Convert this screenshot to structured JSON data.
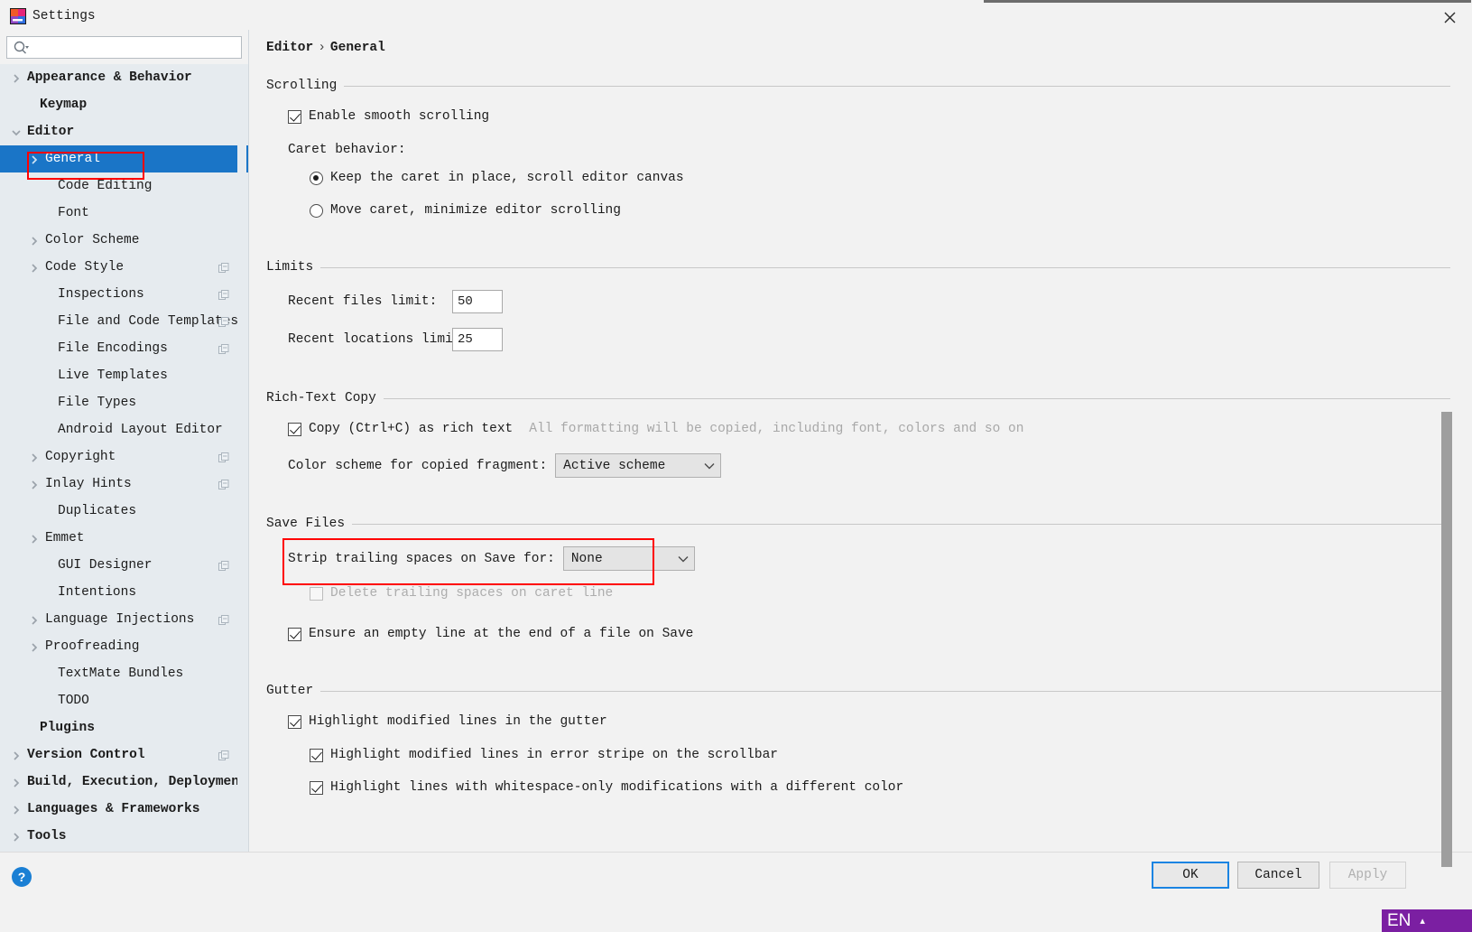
{
  "window": {
    "title": "Settings",
    "app_icon": "jetbrains-icon",
    "close_icon": "close-icon"
  },
  "search": {
    "value": "",
    "placeholder": "",
    "icon": "search-icon"
  },
  "sidebar": {
    "items": [
      {
        "label": "Appearance & Behavior",
        "indent": 16,
        "arrow": "chevron-right",
        "bold": true,
        "badge": false,
        "selected": false
      },
      {
        "label": "Keymap",
        "indent": 30,
        "arrow": "none",
        "bold": true,
        "badge": false,
        "selected": false
      },
      {
        "label": "Editor",
        "indent": 16,
        "arrow": "chevron-down",
        "bold": true,
        "badge": false,
        "selected": false
      },
      {
        "label": "General",
        "indent": 36,
        "arrow": "chevron-right",
        "bold": false,
        "badge": false,
        "selected": true
      },
      {
        "label": "Code Editing",
        "indent": 50,
        "arrow": "none",
        "bold": false,
        "badge": false,
        "selected": false
      },
      {
        "label": "Font",
        "indent": 50,
        "arrow": "none",
        "bold": false,
        "badge": false,
        "selected": false
      },
      {
        "label": "Color Scheme",
        "indent": 36,
        "arrow": "chevron-right",
        "bold": false,
        "badge": false,
        "selected": false
      },
      {
        "label": "Code Style",
        "indent": 36,
        "arrow": "chevron-right",
        "bold": false,
        "badge": true,
        "selected": false
      },
      {
        "label": "Inspections",
        "indent": 50,
        "arrow": "none",
        "bold": false,
        "badge": true,
        "selected": false
      },
      {
        "label": "File and Code Templates",
        "indent": 50,
        "arrow": "none",
        "bold": false,
        "badge": true,
        "selected": false
      },
      {
        "label": "File Encodings",
        "indent": 50,
        "arrow": "none",
        "bold": false,
        "badge": true,
        "selected": false
      },
      {
        "label": "Live Templates",
        "indent": 50,
        "arrow": "none",
        "bold": false,
        "badge": false,
        "selected": false
      },
      {
        "label": "File Types",
        "indent": 50,
        "arrow": "none",
        "bold": false,
        "badge": false,
        "selected": false
      },
      {
        "label": "Android Layout Editor",
        "indent": 50,
        "arrow": "none",
        "bold": false,
        "badge": false,
        "selected": false
      },
      {
        "label": "Copyright",
        "indent": 36,
        "arrow": "chevron-right",
        "bold": false,
        "badge": true,
        "selected": false
      },
      {
        "label": "Inlay Hints",
        "indent": 36,
        "arrow": "chevron-right",
        "bold": false,
        "badge": true,
        "selected": false
      },
      {
        "label": "Duplicates",
        "indent": 50,
        "arrow": "none",
        "bold": false,
        "badge": false,
        "selected": false
      },
      {
        "label": "Emmet",
        "indent": 36,
        "arrow": "chevron-right",
        "bold": false,
        "badge": false,
        "selected": false
      },
      {
        "label": "GUI Designer",
        "indent": 50,
        "arrow": "none",
        "bold": false,
        "badge": true,
        "selected": false
      },
      {
        "label": "Intentions",
        "indent": 50,
        "arrow": "none",
        "bold": false,
        "badge": false,
        "selected": false
      },
      {
        "label": "Language Injections",
        "indent": 36,
        "arrow": "chevron-right",
        "bold": false,
        "badge": true,
        "selected": false
      },
      {
        "label": "Proofreading",
        "indent": 36,
        "arrow": "chevron-right",
        "bold": false,
        "badge": false,
        "selected": false
      },
      {
        "label": "TextMate Bundles",
        "indent": 50,
        "arrow": "none",
        "bold": false,
        "badge": false,
        "selected": false
      },
      {
        "label": "TODO",
        "indent": 50,
        "arrow": "none",
        "bold": false,
        "badge": false,
        "selected": false
      },
      {
        "label": "Plugins",
        "indent": 30,
        "arrow": "none",
        "bold": true,
        "badge": false,
        "selected": false
      },
      {
        "label": "Version Control",
        "indent": 16,
        "arrow": "chevron-right",
        "bold": true,
        "badge": true,
        "selected": false
      },
      {
        "label": "Build, Execution, Deployment",
        "indent": 16,
        "arrow": "chevron-right",
        "bold": true,
        "badge": false,
        "selected": false
      },
      {
        "label": "Languages & Frameworks",
        "indent": 16,
        "arrow": "chevron-right",
        "bold": true,
        "badge": false,
        "selected": false
      },
      {
        "label": "Tools",
        "indent": 16,
        "arrow": "chevron-right",
        "bold": true,
        "badge": false,
        "selected": false
      }
    ]
  },
  "breadcrumb": {
    "root": "Editor",
    "separator": "›",
    "leaf": "General"
  },
  "sections": {
    "scrolling": {
      "title": "Scrolling",
      "enable_smooth_scrolling": {
        "label": "Enable smooth scrolling",
        "checked": true
      },
      "caret_behavior_label": "Caret behavior:",
      "caret_options": [
        {
          "label": "Keep the caret in place, scroll editor canvas",
          "selected": true
        },
        {
          "label": "Move caret, minimize editor scrolling",
          "selected": false
        }
      ]
    },
    "limits": {
      "title": "Limits",
      "recent_files_label": "Recent files limit:",
      "recent_files_value": "50",
      "recent_locations_label": "Recent locations limit:",
      "recent_locations_value": "25"
    },
    "rich_text_copy": {
      "title": "Rich-Text Copy",
      "copy_as_rich_text": {
        "label": "Copy (Ctrl+C) as rich text",
        "checked": true
      },
      "copy_hint": "All formatting will be copied, including font, colors and so on",
      "color_scheme_label": "Color scheme for copied fragment:",
      "color_scheme_value": "Active scheme"
    },
    "save_files": {
      "title": "Save Files",
      "strip_label": "Strip trailing spaces on Save for:",
      "strip_value": "None",
      "delete_trailing": {
        "label": "Delete trailing spaces on caret line",
        "checked": false,
        "disabled": true
      },
      "ensure_empty_line": {
        "label": "Ensure an empty line at the end of a file on Save",
        "checked": true
      }
    },
    "gutter": {
      "title": "Gutter",
      "highlight_modified": {
        "label": "Highlight modified lines in the gutter",
        "checked": true
      },
      "highlight_error_stripe": {
        "label": "Highlight modified lines in error stripe on the scrollbar",
        "checked": true
      },
      "highlight_whitespace": {
        "label": "Highlight lines with whitespace-only modifications with a different color",
        "checked": true
      }
    }
  },
  "footer": {
    "help_label": "?",
    "ok_label": "OK",
    "cancel_label": "Cancel",
    "apply_label": "Apply"
  },
  "ime": {
    "language": "EN",
    "caret": "▴"
  },
  "colors": {
    "selection_blue": "#1a75c7",
    "annotation_red": "#ff0000",
    "focus_blue": "#1a84e2",
    "ime_purple": "#7b1fa2",
    "sidebar_bg": "#e6ebef",
    "panel_bg": "#f2f2f2"
  }
}
